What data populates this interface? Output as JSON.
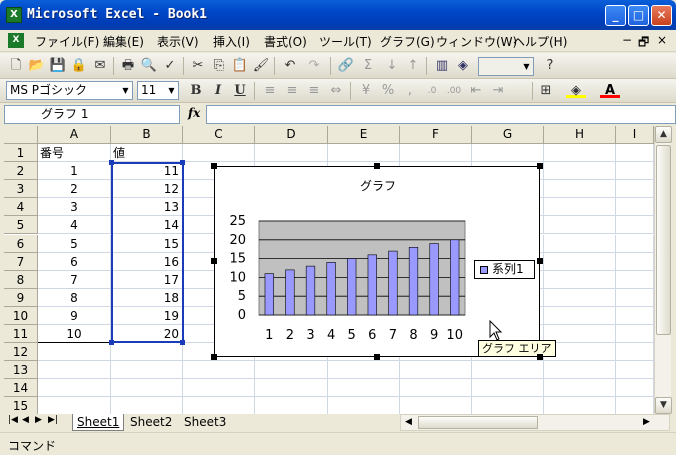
{
  "window": {
    "title": "Microsoft Excel - Book1",
    "app_icon": "X",
    "minimize": "_",
    "maximize": "□",
    "close": "✕"
  },
  "menu": {
    "items": [
      "ファイル(F)",
      "編集(E)",
      "表示(V)",
      "挿入(I)",
      "書式(O)",
      "ツール(T)",
      "グラフ(G)",
      "ウィンドウ(W)",
      "ヘルプ(H)"
    ],
    "help_placeholder": "",
    "win_min": "−",
    "win_restore": "🗗",
    "win_close": "×"
  },
  "format_toolbar": {
    "font": "MS Pゴシック",
    "size": "11",
    "bold": "B",
    "italic": "I",
    "underline": "U"
  },
  "formula_bar": {
    "name_box": "グラフ 1",
    "fx": "fx",
    "content": ""
  },
  "columns": [
    "A",
    "B",
    "C",
    "D",
    "E",
    "F",
    "G",
    "H",
    "I"
  ],
  "rows": [
    "1",
    "2",
    "3",
    "4",
    "5",
    "6",
    "7",
    "8",
    "9",
    "10",
    "11",
    "12",
    "13",
    "14",
    "15"
  ],
  "sheet": {
    "header_a": "番号",
    "header_b": "値",
    "data": [
      [
        "1",
        "11"
      ],
      [
        "2",
        "12"
      ],
      [
        "3",
        "13"
      ],
      [
        "4",
        "14"
      ],
      [
        "5",
        "15"
      ],
      [
        "6",
        "16"
      ],
      [
        "7",
        "17"
      ],
      [
        "8",
        "18"
      ],
      [
        "9",
        "19"
      ],
      [
        "10",
        "20"
      ]
    ]
  },
  "chart_data": {
    "type": "bar",
    "title": "グラフ",
    "categories": [
      "1",
      "2",
      "3",
      "4",
      "5",
      "6",
      "7",
      "8",
      "9",
      "10"
    ],
    "series": [
      {
        "name": "系列1",
        "values": [
          11,
          12,
          13,
          14,
          15,
          16,
          17,
          18,
          19,
          20
        ]
      }
    ],
    "yticks": [
      "0",
      "5",
      "10",
      "15",
      "20",
      "25"
    ],
    "ylim": [
      0,
      25
    ],
    "grid": true,
    "legend_position": "right",
    "bar_color": "#9999ff",
    "plot_area_color": "#c0c0c0"
  },
  "tooltip": "グラフ エリア",
  "sheet_tabs": [
    "Sheet1",
    "Sheet2",
    "Sheet3"
  ],
  "status": "コマンド"
}
